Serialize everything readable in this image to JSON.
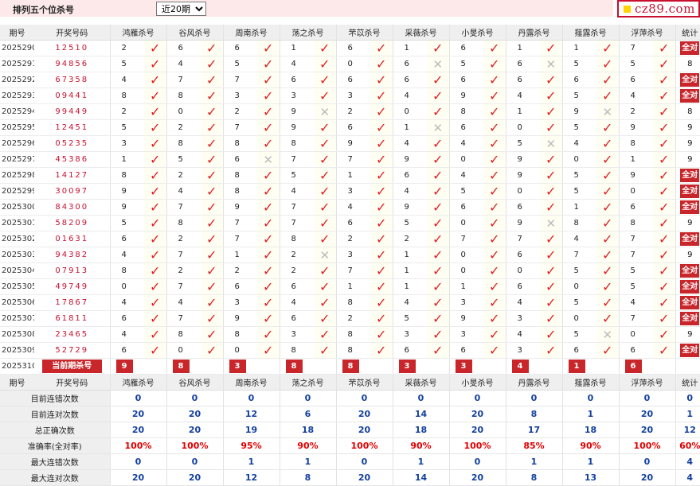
{
  "header": {
    "title": "排列五个位杀号",
    "select_value": "近20期",
    "logo": "cz89.com"
  },
  "columns": {
    "period": "期号",
    "draw": "开奖号码",
    "stat": "统计",
    "experts": [
      "鸿雁杀号",
      "谷风杀号",
      "周南杀号",
      "荡之杀号",
      "芣苡杀号",
      "采薇杀号",
      "小旻杀号",
      "丹露杀号",
      "薤露杀号",
      "浮萍杀号"
    ]
  },
  "rows": [
    {
      "period": "2025290",
      "draw": "12510",
      "kills": [
        2,
        6,
        6,
        1,
        6,
        1,
        6,
        1,
        1,
        7
      ],
      "marks": [
        1,
        1,
        1,
        1,
        1,
        1,
        1,
        1,
        1,
        1
      ],
      "stat": "全对"
    },
    {
      "period": "2025291",
      "draw": "94856",
      "kills": [
        5,
        4,
        5,
        4,
        0,
        6,
        5,
        6,
        5,
        5
      ],
      "marks": [
        1,
        1,
        1,
        1,
        1,
        0,
        1,
        0,
        1,
        1
      ],
      "stat": "8"
    },
    {
      "period": "2025292",
      "draw": "67358",
      "kills": [
        4,
        7,
        7,
        6,
        6,
        6,
        6,
        6,
        6,
        6
      ],
      "marks": [
        1,
        1,
        1,
        1,
        1,
        1,
        1,
        1,
        1,
        1
      ],
      "stat": "全对"
    },
    {
      "period": "2025293",
      "draw": "09441",
      "kills": [
        8,
        8,
        3,
        3,
        3,
        4,
        9,
        4,
        5,
        4
      ],
      "marks": [
        1,
        1,
        1,
        1,
        1,
        1,
        1,
        1,
        1,
        1
      ],
      "stat": "全对"
    },
    {
      "period": "2025294",
      "draw": "99449",
      "kills": [
        2,
        0,
        2,
        9,
        2,
        0,
        8,
        1,
        9,
        2
      ],
      "marks": [
        1,
        1,
        1,
        0,
        1,
        1,
        1,
        1,
        0,
        1
      ],
      "stat": "8"
    },
    {
      "period": "2025295",
      "draw": "12451",
      "kills": [
        5,
        2,
        7,
        9,
        6,
        1,
        6,
        0,
        5,
        9
      ],
      "marks": [
        1,
        1,
        1,
        1,
        1,
        0,
        1,
        1,
        1,
        1
      ],
      "stat": "9"
    },
    {
      "period": "2025296",
      "draw": "05235",
      "kills": [
        3,
        8,
        8,
        8,
        9,
        4,
        4,
        5,
        4,
        8
      ],
      "marks": [
        1,
        1,
        1,
        1,
        1,
        1,
        1,
        0,
        1,
        1
      ],
      "stat": "9"
    },
    {
      "period": "2025297",
      "draw": "45386",
      "kills": [
        1,
        5,
        6,
        7,
        7,
        9,
        0,
        9,
        0,
        1
      ],
      "marks": [
        1,
        1,
        0,
        1,
        1,
        1,
        1,
        1,
        1,
        1
      ],
      "stat": "9"
    },
    {
      "period": "2025298",
      "draw": "14127",
      "kills": [
        8,
        2,
        8,
        5,
        1,
        6,
        4,
        9,
        5,
        9
      ],
      "marks": [
        1,
        1,
        1,
        1,
        1,
        1,
        1,
        1,
        1,
        1
      ],
      "stat": "全对"
    },
    {
      "period": "2025299",
      "draw": "30097",
      "kills": [
        9,
        4,
        8,
        4,
        3,
        4,
        5,
        0,
        5,
        0
      ],
      "marks": [
        1,
        1,
        1,
        1,
        1,
        1,
        1,
        1,
        1,
        1
      ],
      "stat": "全对"
    },
    {
      "period": "2025300",
      "draw": "84300",
      "kills": [
        9,
        7,
        9,
        7,
        4,
        9,
        6,
        6,
        1,
        6
      ],
      "marks": [
        1,
        1,
        1,
        1,
        1,
        1,
        1,
        1,
        1,
        1
      ],
      "stat": "全对"
    },
    {
      "period": "2025301",
      "draw": "58209",
      "kills": [
        5,
        8,
        7,
        7,
        6,
        5,
        0,
        9,
        8,
        8
      ],
      "marks": [
        1,
        1,
        1,
        1,
        1,
        1,
        1,
        0,
        1,
        1
      ],
      "stat": "9"
    },
    {
      "period": "2025302",
      "draw": "01631",
      "kills": [
        6,
        2,
        7,
        8,
        2,
        2,
        7,
        7,
        4,
        7
      ],
      "marks": [
        1,
        1,
        1,
        1,
        1,
        1,
        1,
        1,
        1,
        1
      ],
      "stat": "全对"
    },
    {
      "period": "2025303",
      "draw": "94382",
      "kills": [
        4,
        7,
        1,
        2,
        3,
        1,
        0,
        6,
        7,
        7
      ],
      "marks": [
        1,
        1,
        1,
        0,
        1,
        1,
        1,
        1,
        1,
        1
      ],
      "stat": "9"
    },
    {
      "period": "2025304",
      "draw": "07913",
      "kills": [
        8,
        2,
        2,
        2,
        7,
        1,
        0,
        0,
        5,
        5
      ],
      "marks": [
        1,
        1,
        1,
        1,
        1,
        1,
        1,
        1,
        1,
        1
      ],
      "stat": "全对"
    },
    {
      "period": "2025305",
      "draw": "49749",
      "kills": [
        0,
        7,
        6,
        6,
        1,
        1,
        1,
        6,
        0,
        5
      ],
      "marks": [
        1,
        1,
        1,
        1,
        1,
        1,
        1,
        1,
        1,
        1
      ],
      "stat": "全对"
    },
    {
      "period": "2025306",
      "draw": "17867",
      "kills": [
        4,
        4,
        3,
        4,
        8,
        4,
        3,
        4,
        5,
        4
      ],
      "marks": [
        1,
        1,
        1,
        1,
        1,
        1,
        1,
        1,
        1,
        1
      ],
      "stat": "全对"
    },
    {
      "period": "2025307",
      "draw": "61811",
      "kills": [
        6,
        7,
        9,
        6,
        2,
        5,
        9,
        3,
        0,
        7
      ],
      "marks": [
        1,
        1,
        1,
        1,
        1,
        1,
        1,
        1,
        1,
        1
      ],
      "stat": "全对"
    },
    {
      "period": "2025308",
      "draw": "23465",
      "kills": [
        4,
        8,
        8,
        3,
        8,
        3,
        3,
        4,
        5,
        0
      ],
      "marks": [
        1,
        1,
        1,
        1,
        1,
        1,
        1,
        1,
        0,
        1
      ],
      "stat": "9"
    },
    {
      "period": "2025309",
      "draw": "52729",
      "kills": [
        6,
        0,
        0,
        8,
        8,
        6,
        6,
        3,
        6,
        6
      ],
      "marks": [
        1,
        1,
        1,
        1,
        1,
        1,
        1,
        1,
        1,
        1
      ],
      "stat": "全对"
    }
  ],
  "current": {
    "period": "2025310",
    "label": "当前期杀号",
    "kills": [
      9,
      8,
      3,
      8,
      8,
      3,
      3,
      4,
      1,
      6
    ]
  },
  "summary": [
    {
      "label": "目前连错次数",
      "values": [
        "0",
        "0",
        "0",
        "0",
        "0",
        "0",
        "0",
        "0",
        "0",
        "0"
      ],
      "stat": "0"
    },
    {
      "label": "目前连对次数",
      "values": [
        "20",
        "20",
        "12",
        "6",
        "20",
        "14",
        "20",
        "8",
        "1",
        "20"
      ],
      "stat": "1"
    },
    {
      "label": "总正确次数",
      "values": [
        "20",
        "20",
        "19",
        "18",
        "20",
        "18",
        "20",
        "17",
        "18",
        "20"
      ],
      "stat": "12"
    },
    {
      "label": "准确率(全对率)",
      "values": [
        "100%",
        "100%",
        "95%",
        "90%",
        "100%",
        "90%",
        "100%",
        "85%",
        "90%",
        "100%"
      ],
      "stat": "60%"
    },
    {
      "label": "最大连错次数",
      "values": [
        "0",
        "0",
        "1",
        "1",
        "0",
        "1",
        "0",
        "1",
        "1",
        "0"
      ],
      "stat": "4"
    },
    {
      "label": "最大连对次数",
      "values": [
        "20",
        "20",
        "12",
        "8",
        "20",
        "14",
        "20",
        "8",
        "13",
        "20"
      ],
      "stat": "4"
    }
  ],
  "icons": {
    "correct": "check-icon",
    "wrong": "cross-icon"
  },
  "colors": {
    "accent": "#c8262b",
    "check": "#e02020",
    "summary_blue": "#123fa0",
    "header_bg": "#efefef"
  }
}
